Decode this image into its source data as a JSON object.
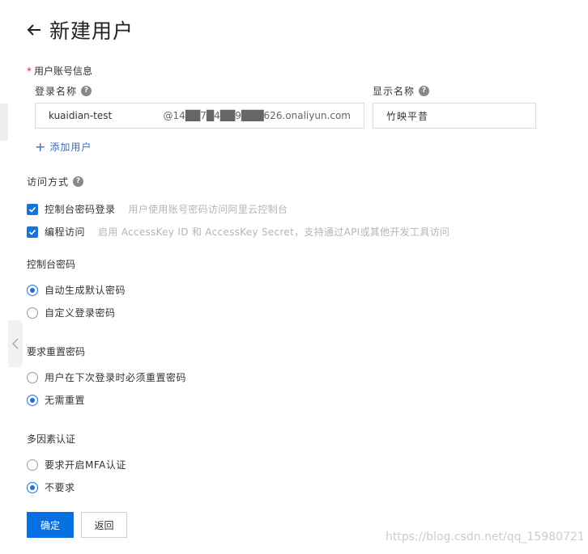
{
  "header": {
    "title": "新建用户"
  },
  "account": {
    "section_label": "用户账号信息",
    "required_mark": "*",
    "login_label": "登录名称",
    "login_value": "kuaidian-test",
    "login_suffix": "@14██7█4██9███626.onaliyun.com",
    "display_label": "显示名称",
    "display_value": "竹映平昔",
    "add_user": "添加用户"
  },
  "access": {
    "label": "访问方式",
    "options": [
      {
        "label": "控制台密码登录",
        "desc": "用户使用账号密码访问阿里云控制台",
        "checked": true
      },
      {
        "label": "编程访问",
        "desc": "启用 AccessKey ID 和 AccessKey Secret，支持通过API或其他开发工具访问",
        "checked": true
      }
    ]
  },
  "console_password": {
    "label": "控制台密码",
    "options": [
      {
        "label": "自动生成默认密码",
        "checked": true
      },
      {
        "label": "自定义登录密码",
        "checked": false
      }
    ]
  },
  "reset_password": {
    "label": "要求重置密码",
    "options": [
      {
        "label": "用户在下次登录时必须重置密码",
        "checked": false
      },
      {
        "label": "无需重置",
        "checked": true
      }
    ]
  },
  "mfa": {
    "label": "多因素认证",
    "options": [
      {
        "label": "要求开启MFA认证",
        "checked": false
      },
      {
        "label": "不要求",
        "checked": true
      }
    ]
  },
  "buttons": {
    "confirm": "确定",
    "back": "返回"
  },
  "watermark": "https://blog.csdn.net/qq_15980721",
  "colors": {
    "primary": "#0770e3",
    "link": "#2b6fd1",
    "required": "#e5252a"
  },
  "icons": {
    "back": "arrow-left-icon",
    "help": "question-circle-icon",
    "collapse": "chevron-left-icon",
    "add": "plus-icon"
  }
}
